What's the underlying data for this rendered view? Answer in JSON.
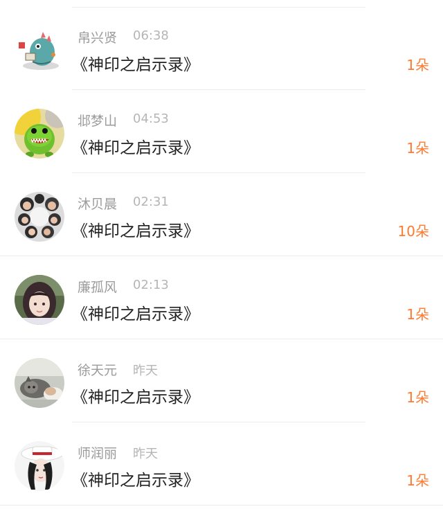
{
  "gifts": [
    {
      "name": "帛兴贤",
      "time": "06:38",
      "title": "《神印之启示录》",
      "count": "1朵",
      "avatar": "cartoon-dinosaur-icon"
    },
    {
      "name": "邶梦山",
      "time": "04:53",
      "title": "《神印之启示录》",
      "count": "1朵",
      "avatar": "green-monster-icon"
    },
    {
      "name": "沐贝晨",
      "time": "02:31",
      "title": "《神印之启示录》",
      "count": "10朵",
      "avatar": "group-photo-icon"
    },
    {
      "name": "廉孤风",
      "time": "02:13",
      "title": "《神印之启示录》",
      "count": "1朵",
      "avatar": "girl-portrait-icon"
    },
    {
      "name": "徐天元",
      "time": "昨天",
      "title": "《神印之启示录》",
      "count": "1朵",
      "avatar": "cat-photo-icon"
    },
    {
      "name": "师润丽",
      "time": "昨天",
      "title": "《神印之启示录》",
      "count": "1朵",
      "avatar": "girl-hat-icon"
    }
  ],
  "colors": {
    "accent": "#ff7a2f",
    "name_text": "#9b9b9b",
    "time_text": "#b5b5b5",
    "title_text": "#222222",
    "divider": "#ececec"
  }
}
